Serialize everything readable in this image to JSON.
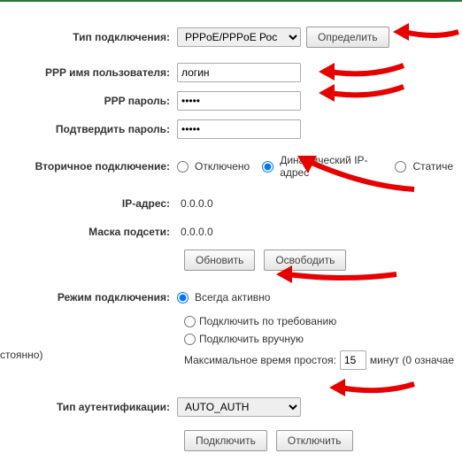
{
  "labels": {
    "connection_type": "Тип подключения:",
    "ppp_user": "PPP имя пользователя:",
    "ppp_pass": "PPP пароль:",
    "ppp_conf": "Подтвердить пароль:",
    "secondary": "Вторичное подключение:",
    "ip": "IP-адрес:",
    "mask": "Маска подсети:",
    "mode": "Режим подключения:",
    "auth": "Тип аутентификации:"
  },
  "fields": {
    "connection_type_selected": "PPPoE/PPPoE Рос",
    "ppp_user_value": "логин",
    "ppp_pass_value": "•••••",
    "ppp_conf_value": "•••••",
    "ip_value": "0.0.0.0",
    "mask_value": "0.0.0.0",
    "idle_value": "15",
    "auth_selected": "AUTO_AUTH"
  },
  "buttons": {
    "detect": "Определить",
    "renew": "Обновить",
    "release": "Освободить",
    "connect": "Подключить",
    "disconnect": "Отключить"
  },
  "radios": {
    "secondary_disabled": "Отключено",
    "secondary_dynamic": "Динамический IP-адрес",
    "secondary_static": "Статиче",
    "mode_always": "Всегда активно",
    "mode_demand": "Подключить по требованию",
    "mode_manual": "Подключить вручную"
  },
  "texts": {
    "idle_prefix": "Максимальное время простоя:",
    "idle_suffix": "минут (0 означае",
    "left_cut": "стоянно)"
  }
}
